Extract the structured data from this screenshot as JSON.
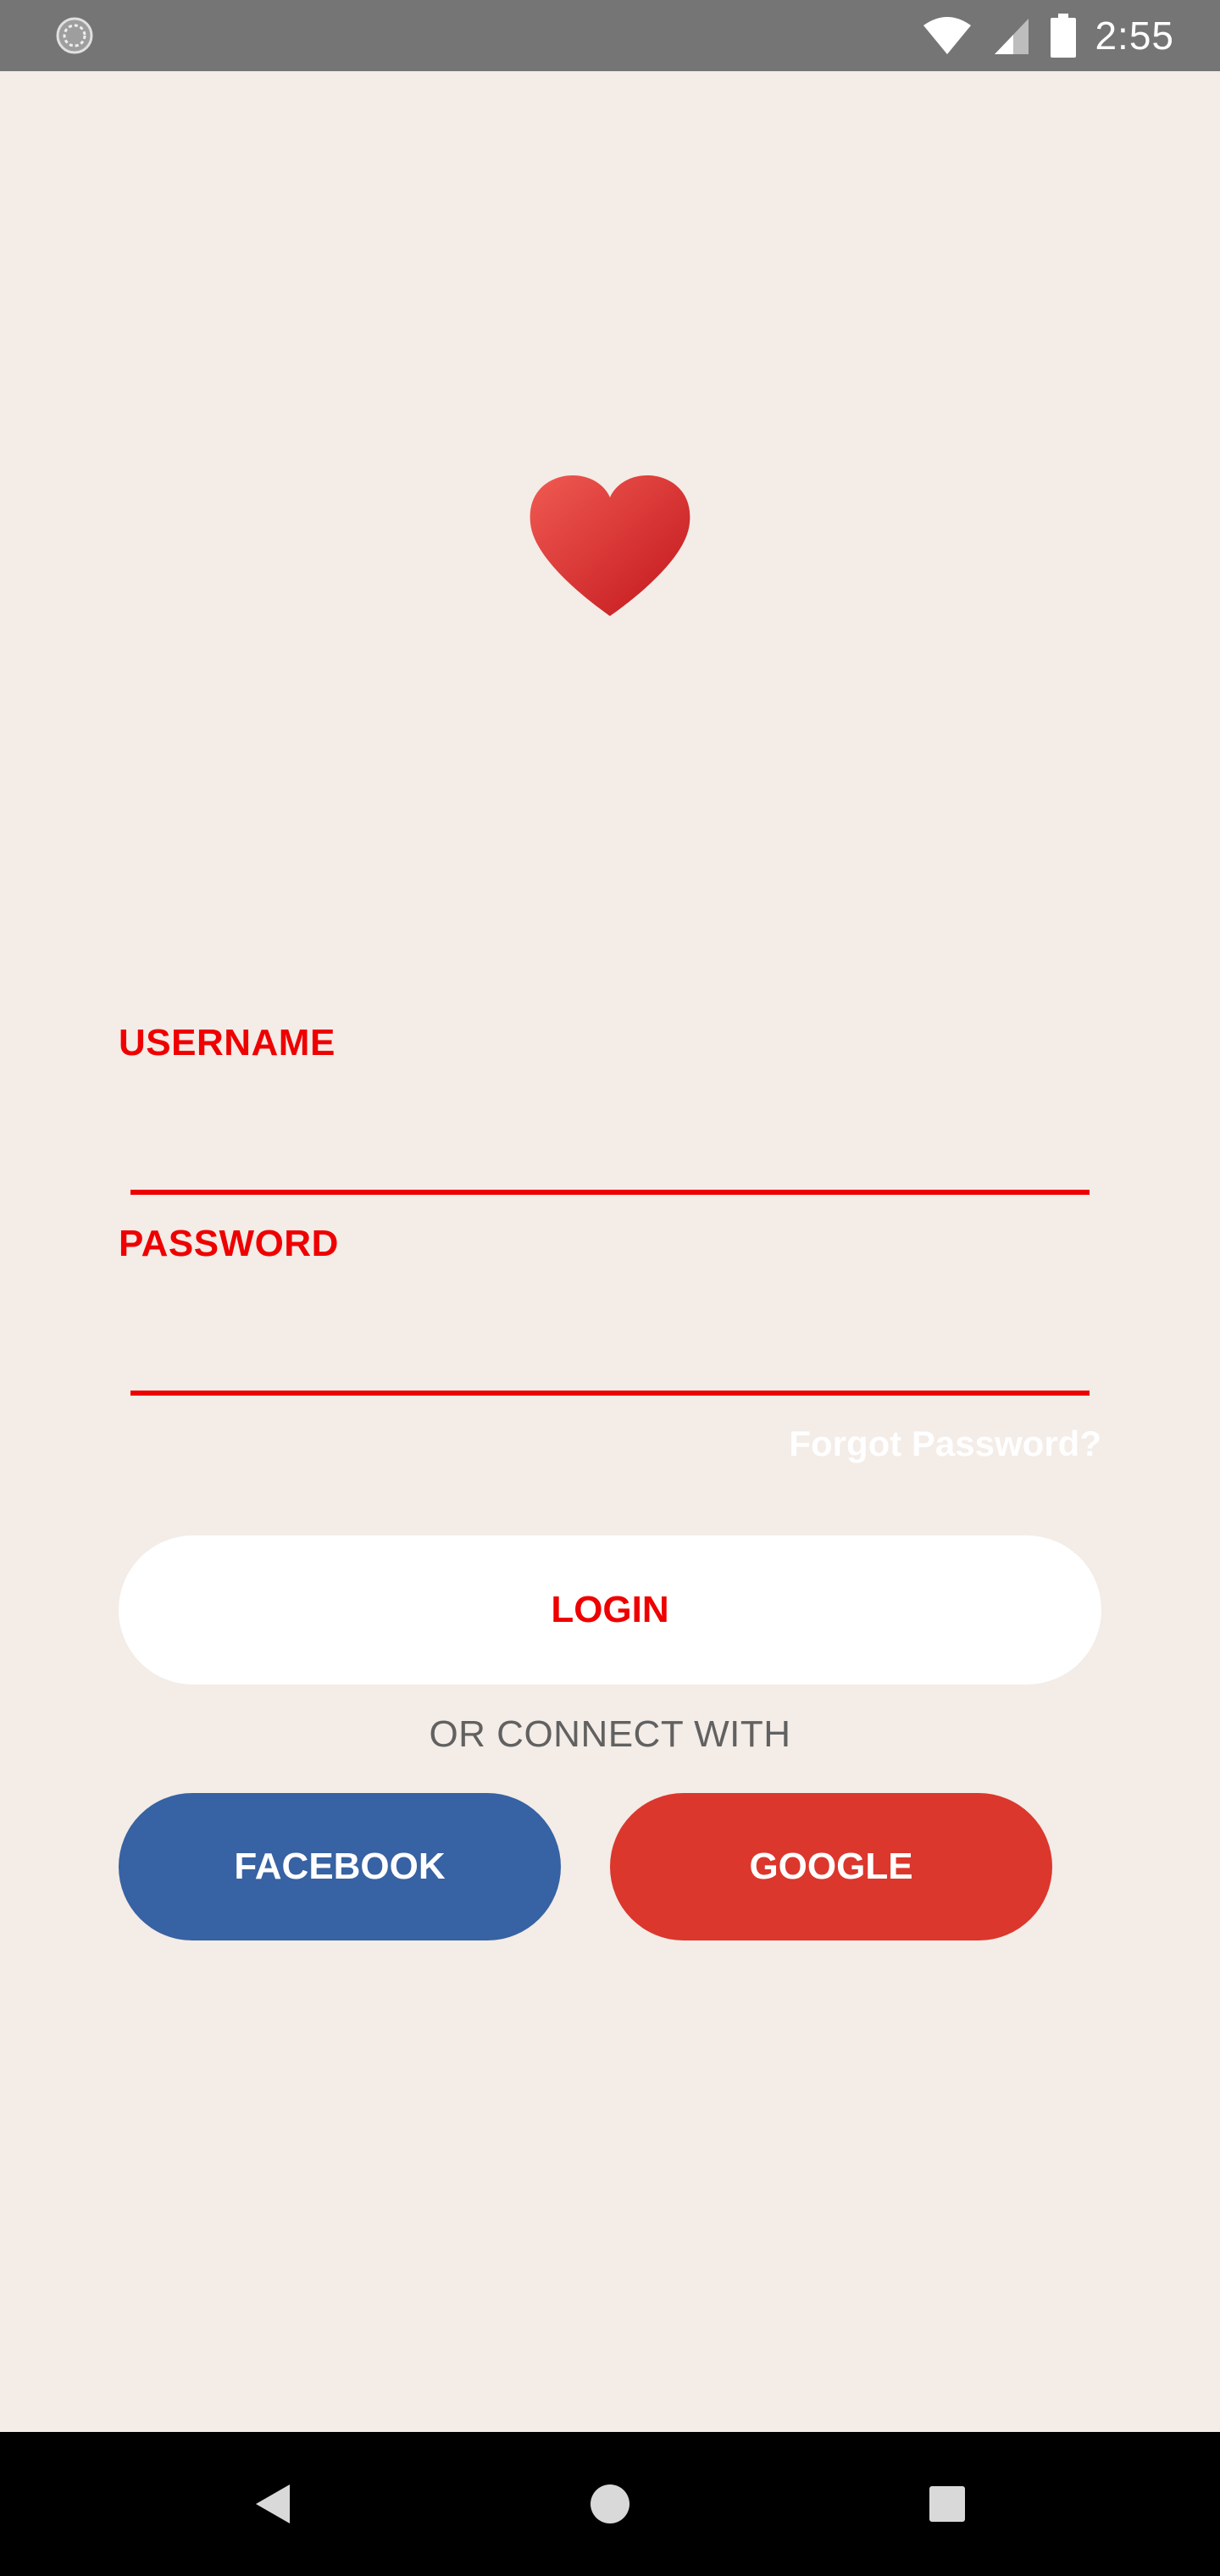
{
  "status_bar": {
    "time": "2:55",
    "left_icon": "sync-icon",
    "icons": [
      "wifi-icon",
      "signal-icon",
      "battery-icon"
    ]
  },
  "logo": {
    "icon": "heart-icon",
    "color": "#e53935"
  },
  "form": {
    "username_label": "USERNAME",
    "username_value": "",
    "password_label": "PASSWORD",
    "password_value": "",
    "forgot_password": "Forgot Password?",
    "login_label": "LOGIN"
  },
  "social": {
    "or_connect_text": "OR CONNECT WITH",
    "facebook_label": "FACEBOOK",
    "google_label": "GOOGLE"
  },
  "colors": {
    "accent": "#ee0000",
    "background": "#f3ece7",
    "facebook": "#3762a3",
    "google": "#db372d"
  },
  "nav_bar": {
    "icons": [
      "back-icon",
      "home-icon",
      "recents-icon"
    ]
  }
}
